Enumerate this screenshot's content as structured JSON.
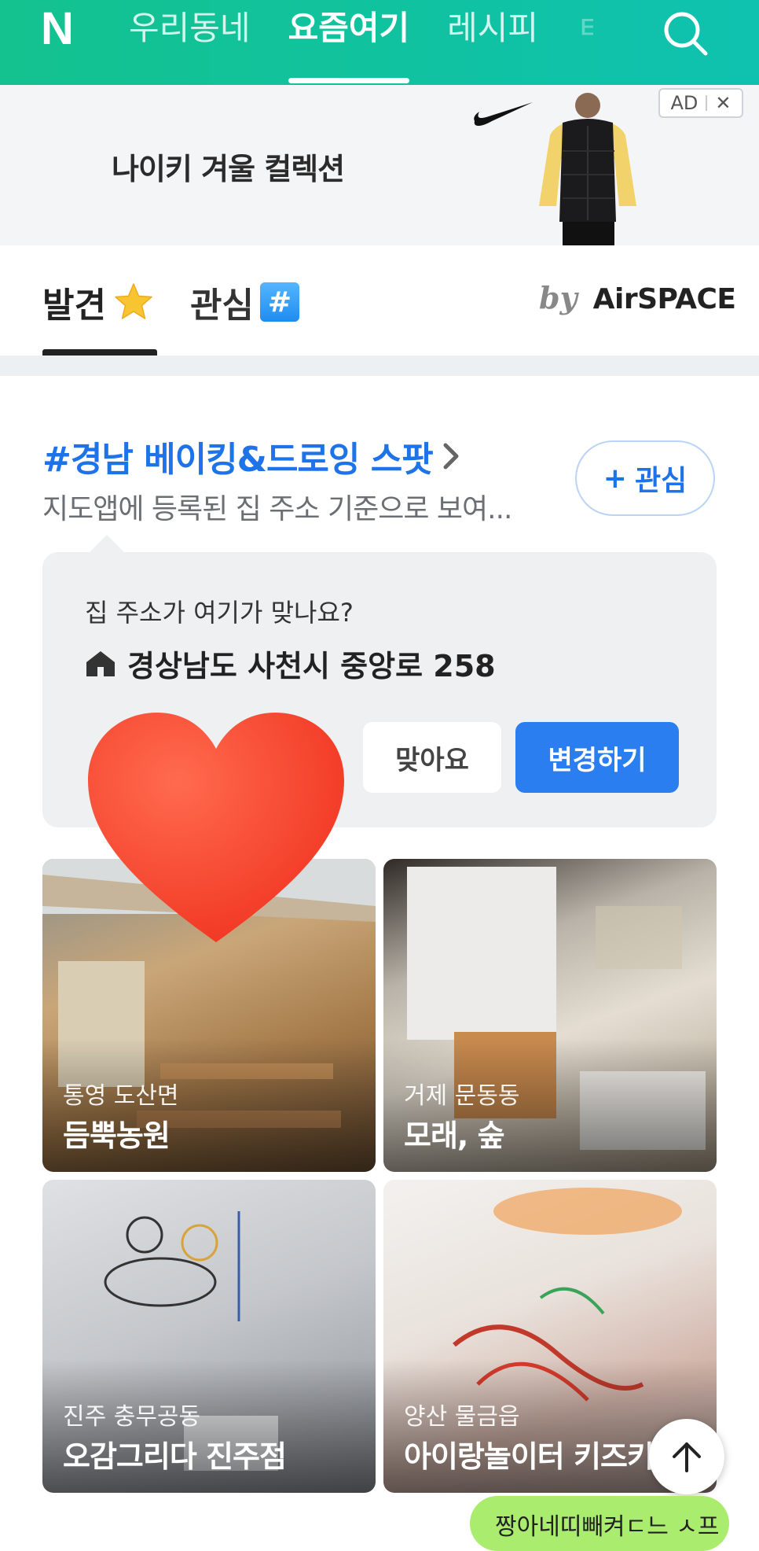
{
  "nav": {
    "logo": "N",
    "tabs": [
      {
        "label": "우리동네"
      },
      {
        "label": "요즘여기"
      },
      {
        "label": "레시피"
      },
      {
        "label": "ㅌ"
      }
    ],
    "active_tab_index": 1,
    "search_icon": "search-icon"
  },
  "ad": {
    "text": "나이키 겨울 컬렉션",
    "badge_label": "AD",
    "close_label": "✕"
  },
  "subtabs": {
    "discover_label": "발견",
    "interest_label": "관심",
    "interest_icon_text": "#",
    "by_label": "by",
    "brand_label": "AirSPACE"
  },
  "topic": {
    "title": "#경남 베이킹&드로잉 스팟",
    "subtitle": "지도앱에 등록된 집 주소 기준으로 보여...",
    "follow_label": "관심",
    "follow_prefix": "+"
  },
  "address_card": {
    "question": "집 주소가 여기가 맞나요?",
    "address": "경상남도 사천시 중앙로 258",
    "confirm_label": "맞아요",
    "change_label": "변경하기"
  },
  "places": [
    {
      "location": "통영 도산면",
      "name": "듬뿍농원"
    },
    {
      "location": "거제 문동동",
      "name": "모래, 숲"
    },
    {
      "location": "진주 충무공동",
      "name": "오감그리다 진주점"
    },
    {
      "location": "양산 물금읍",
      "name": "아이랑놀이터 키즈키..."
    }
  ],
  "bottom_pill": {
    "text": "짱아네띠빼켜ㄷ느 ㅅ프"
  },
  "colors": {
    "nav_green": "#13c28e",
    "accent_blue": "#1f73e8",
    "button_blue": "#2b7ef0"
  }
}
